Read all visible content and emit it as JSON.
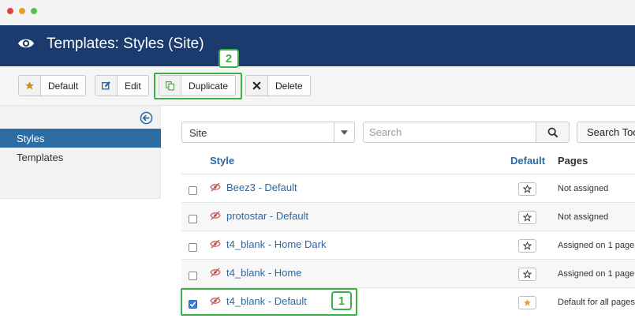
{
  "header": {
    "title": "Templates: Styles (Site)"
  },
  "toolbar": {
    "buttons": [
      {
        "label": "Default",
        "icon": "star-icon"
      },
      {
        "label": "Edit",
        "icon": "edit-icon"
      },
      {
        "label": "Duplicate",
        "icon": "copy-icon"
      },
      {
        "label": "Delete",
        "icon": "close-icon"
      }
    ]
  },
  "annotations": {
    "badge_duplicate": "2",
    "badge_row": "1",
    "highlight_color": "#3db24a"
  },
  "sidebar": {
    "items": [
      {
        "label": "Styles",
        "active": true
      },
      {
        "label": "Templates",
        "active": false
      }
    ]
  },
  "filters": {
    "client_value": "Site",
    "search_placeholder": "Search",
    "search_tools_label": "Search Tools"
  },
  "table": {
    "headers": {
      "style": "Style",
      "default": "Default",
      "pages": "Pages"
    },
    "rows": [
      {
        "name": "Beez3 - Default",
        "default": false,
        "pages": "Not assigned",
        "checked": false
      },
      {
        "name": "protostar - Default",
        "default": false,
        "pages": "Not assigned",
        "checked": false
      },
      {
        "name": "t4_blank - Home Dark",
        "default": false,
        "pages": "Assigned on 1 page",
        "checked": false
      },
      {
        "name": "t4_blank - Home",
        "default": false,
        "pages": "Assigned on 1 page",
        "checked": false
      },
      {
        "name": "t4_blank - Default",
        "default": true,
        "pages": "Default for all pages",
        "checked": true
      }
    ]
  },
  "colors": {
    "header_bg": "#1b3a6e",
    "link": "#2a69a8",
    "active_nav": "#2d6ca2",
    "default_star": "#e0a040"
  }
}
